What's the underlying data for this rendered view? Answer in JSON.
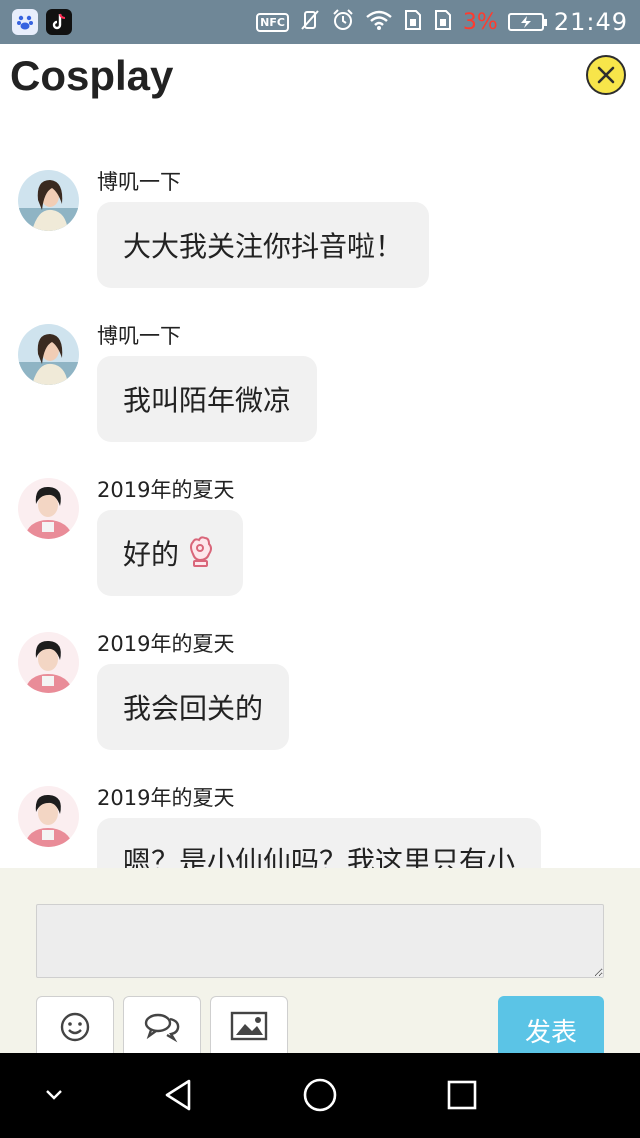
{
  "status_bar": {
    "left_icons": [
      "baidu-app-icon",
      "douyin-app-icon"
    ],
    "nfc_label": "NFC",
    "battery_percent": "3%",
    "time": "21:49"
  },
  "header": {
    "title": "Cosplay"
  },
  "messages": [
    {
      "username": "博叽一下",
      "text": "大大我关注你抖音啦！",
      "avatar": "female-avatar"
    },
    {
      "username": "博叽一下",
      "text": "我叫陌年微凉",
      "avatar": "female-avatar"
    },
    {
      "username": "2019年的夏天",
      "text": "好的",
      "emoji": "ok-hand-emoji",
      "avatar": "male-avatar"
    },
    {
      "username": "2019年的夏天",
      "text": "我会回关的",
      "avatar": "male-avatar"
    },
    {
      "username": "2019年的夏天",
      "text": "嗯？是小仙仙吗？我这里只有小",
      "avatar": "male-avatar"
    }
  ],
  "composer": {
    "input_value": "",
    "tools": [
      "emoji-icon",
      "chat-bubbles-icon",
      "image-icon"
    ],
    "submit_label": "发表"
  },
  "colors": {
    "status_bar": "#6f8797",
    "battery_low": "#ff3b2e",
    "close_button": "#f7e54a",
    "bubble": "#f1f1f1",
    "submit": "#5bc4e6",
    "composer_bg": "#f3f3ea"
  }
}
